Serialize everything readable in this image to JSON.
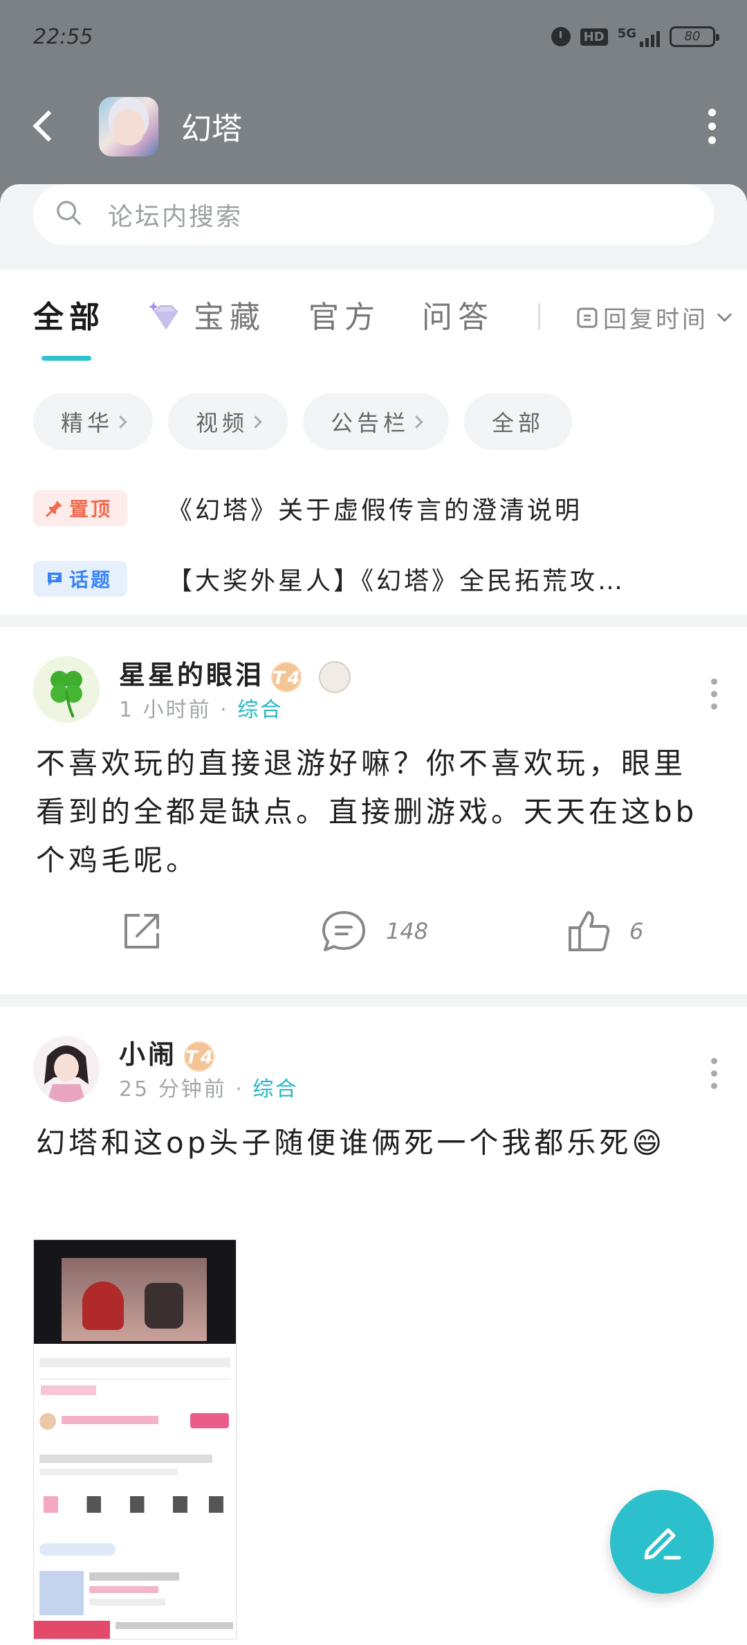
{
  "status_bar": {
    "time": "22:55",
    "network": "5G",
    "hd": "HD",
    "battery": "80"
  },
  "header": {
    "title": "幻塔"
  },
  "search": {
    "placeholder": "论坛内搜索"
  },
  "tabs": [
    {
      "label": "全部"
    },
    {
      "label": "宝藏"
    },
    {
      "label": "官方"
    },
    {
      "label": "问答"
    }
  ],
  "sort": {
    "label": "回复时间"
  },
  "chips": [
    {
      "label": "精华"
    },
    {
      "label": "视频"
    },
    {
      "label": "公告栏"
    },
    {
      "label": "全部"
    }
  ],
  "pinned": [
    {
      "badge": "置顶",
      "text": "《幻塔》关于虚假传言的澄清说明"
    },
    {
      "badge": "话题",
      "text": "【大奖外星人】《幻塔》全民拓荒攻…"
    }
  ],
  "posts": [
    {
      "author": "星星的眼泪",
      "level": "T4",
      "time": "1 小时前",
      "category": "综合",
      "content": "不喜欢玩的直接退游好嘛？你不喜欢玩，眼里看到的全都是缺点。直接删游戏。天天在这bb个鸡毛呢。",
      "comments": "148",
      "likes": "6"
    },
    {
      "author": "小闹",
      "level": "T4",
      "time": "25 分钟前",
      "category": "综合",
      "content": "幻塔和这op头子随便谁俩死一个我都乐死😄"
    }
  ],
  "colors": {
    "accent": "#2cc1cf",
    "header_bg": "#7c8185",
    "pin_badge": "#f06a4f",
    "topic_badge": "#3b82f6"
  },
  "icons": [
    "back-arrow-icon",
    "more-vert-icon",
    "search-icon",
    "gem-icon",
    "sort-icon",
    "pin-icon",
    "topic-icon",
    "share-icon",
    "comment-icon",
    "like-icon",
    "edit-pen-icon"
  ]
}
